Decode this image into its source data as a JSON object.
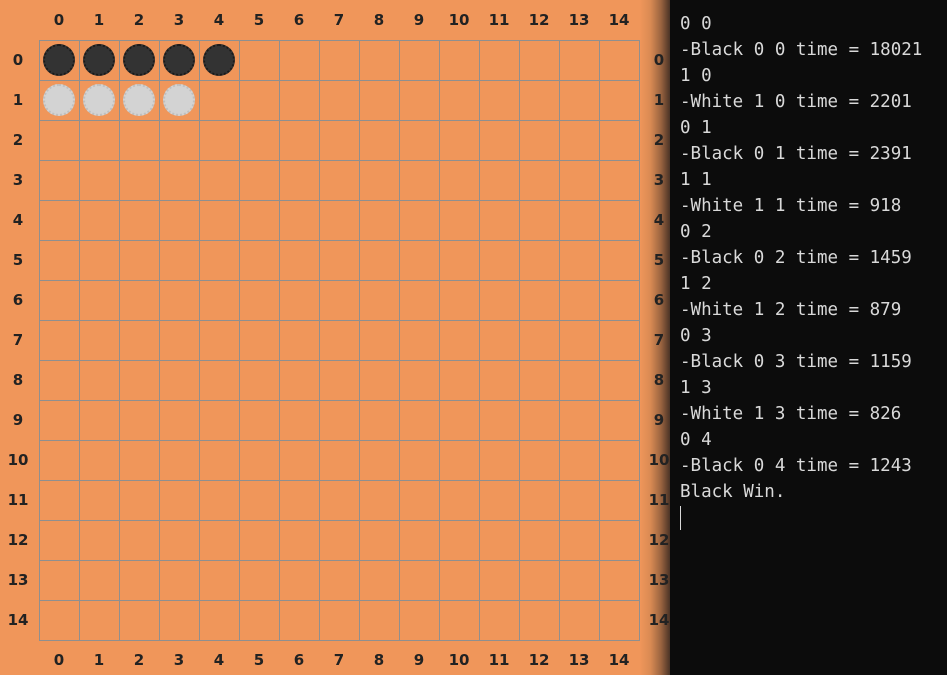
{
  "board": {
    "size": 15,
    "top_labels": [
      "0",
      "1",
      "2",
      "3",
      "4",
      "5",
      "6",
      "7",
      "8",
      "9",
      "10",
      "11",
      "12",
      "13",
      "14"
    ],
    "bottom_labels": [
      "0",
      "1",
      "2",
      "3",
      "4",
      "5",
      "6",
      "7",
      "8",
      "9",
      "10",
      "11",
      "12",
      "13",
      "14"
    ],
    "left_labels": [
      "0",
      "1",
      "2",
      "3",
      "4",
      "5",
      "6",
      "7",
      "8",
      "9",
      "10",
      "11",
      "12",
      "13",
      "14"
    ],
    "right_labels": [
      "0",
      "1",
      "2",
      "3",
      "4",
      "5",
      "6",
      "7",
      "8",
      "9",
      "10",
      "11",
      "12",
      "13",
      "14"
    ],
    "stones": [
      {
        "color": "black",
        "row": 0,
        "col": 0
      },
      {
        "color": "black",
        "row": 0,
        "col": 1
      },
      {
        "color": "black",
        "row": 0,
        "col": 2
      },
      {
        "color": "black",
        "row": 0,
        "col": 3
      },
      {
        "color": "black",
        "row": 0,
        "col": 4
      },
      {
        "color": "white",
        "row": 1,
        "col": 0
      },
      {
        "color": "white",
        "row": 1,
        "col": 1
      },
      {
        "color": "white",
        "row": 1,
        "col": 2
      },
      {
        "color": "white",
        "row": 1,
        "col": 3
      }
    ],
    "colors": {
      "background": "#f0965a",
      "grid_line": "#8f8f8f",
      "black_stone": "#333333",
      "white_stone": "#d3d3d3",
      "label": "#222222"
    }
  },
  "console": {
    "lines": [
      "0 0",
      "-Black 0 0 time = 18021",
      "1 0",
      "-White 1 0 time = 2201",
      "0 1",
      "-Black 0 1 time = 2391",
      "1 1",
      "-White 1 1 time = 918",
      "0 2",
      "-Black 0 2 time = 1459",
      "1 2",
      "-White 1 2 time = 879",
      "0 3",
      "-Black 0 3 time = 1159",
      "1 3",
      "-White 1 3 time = 826",
      "0 4",
      "-Black 0 4 time = 1243",
      "Black Win."
    ],
    "colors": {
      "background": "#0c0c0c",
      "text": "#d9d9d9"
    }
  }
}
